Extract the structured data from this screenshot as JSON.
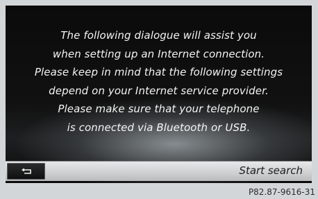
{
  "dialog": {
    "lines": [
      "The following dialogue will assist you",
      "when setting up an Internet connection.",
      "Please keep in mind that the following settings",
      "depend on your Internet service provider.",
      "Please make sure that your telephone",
      "is connected via Bluetooth or USB."
    ]
  },
  "bottom_bar": {
    "back_icon": "back-arrow-icon",
    "action_label": "Start search"
  },
  "footer": {
    "reference": "P82.87-9616-31"
  }
}
